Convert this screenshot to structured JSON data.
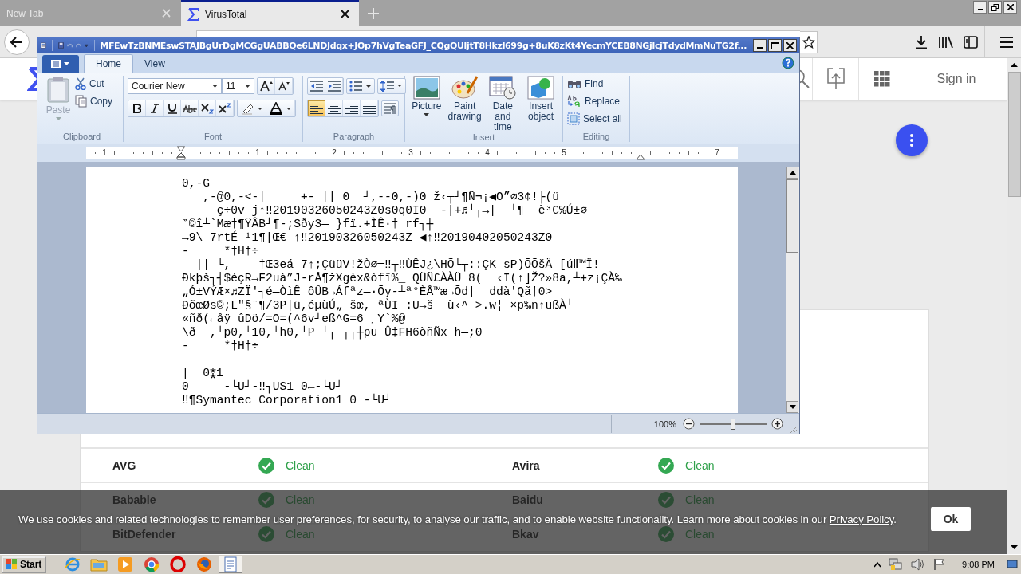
{
  "browser": {
    "tabs": [
      {
        "label": "New Tab",
        "selected": false,
        "icon": false
      },
      {
        "label": "VirusTotal",
        "selected": true,
        "icon": true
      }
    ]
  },
  "site_header": {
    "sign_in": "Sign in"
  },
  "results": {
    "rows": [
      {
        "engine_1": "AVG",
        "result_1": "Clean",
        "engine_2": "Avira",
        "result_2": "Clean"
      },
      {
        "engine_1": "Babable",
        "result_1": "Clean",
        "engine_2": "Baidu",
        "result_2": "Clean"
      },
      {
        "engine_1": "BitDefender",
        "result_1": "Clean",
        "engine_2": "Bkav",
        "result_2": "Clean"
      }
    ]
  },
  "cookie_banner": {
    "text": "We use cookies and related technologies to remember user preferences, for security, to analyse our traffic, and to enable website functionality. Learn more about cookies in our ",
    "link": "Privacy Policy",
    "after": ".",
    "button": "Ok"
  },
  "wordpad": {
    "title": "MFEwTzBNMEswSTAJBgUrDgMCGgUABBQe6LNDJdqx+JOp7hVgTeaGFJ_CQgQUljtT8Hkzl699g+8uK8zKt4YecmYCEB8NGjlcjTdydMmNuTG2f...",
    "tabs": [
      {
        "label": "Home",
        "selected": true
      },
      {
        "label": "View",
        "selected": false
      }
    ],
    "clipboard": {
      "label": "Clipboard",
      "paste": "Paste",
      "cut": "Cut",
      "copy": "Copy"
    },
    "font": {
      "label": "Font",
      "family": "Courier New",
      "size": "11"
    },
    "paragraph": {
      "label": "Paragraph",
      "alignments": [
        {
          "kind": "left",
          "selected": true
        },
        {
          "kind": "center",
          "selected": false
        },
        {
          "kind": "right",
          "selected": false
        },
        {
          "kind": "justify",
          "selected": false
        }
      ]
    },
    "insert": {
      "label": "Insert",
      "items": [
        {
          "kind": "picture",
          "label": "Picture",
          "dropdown": true
        },
        {
          "kind": "paint",
          "label": "Paint drawing",
          "dropdown": false
        },
        {
          "kind": "datetime",
          "label": "Date and time",
          "dropdown": false
        },
        {
          "kind": "object",
          "label": "Insert object",
          "dropdown": false
        }
      ]
    },
    "editing": {
      "label": "Editing",
      "find": "Find",
      "replace": "Replace",
      "select_all": "Select all"
    },
    "ruler": [
      "1",
      "1",
      "2",
      "3",
      "4",
      "5",
      "7"
    ],
    "document": "0,-G\n   ,-@0,-<-|     +- || 0  ┘,--0,-)0 ž‹┬┘¶Ñ¬¡◀Õ”⌀3¢!├(ü\n     ç÷0v j↑‼20190326050243Z0s0q0I0  -|+♬└┐→|  ┘¶  è³C%Ú±⌀\n‶©î┴`Mæ†¶ŸÂB┘¶-;Sðy3—¯}fï.+ÌÊ·† rf┐┼\n→9\\ 7rtÉ ¹1¶|Œ€ ↑‼20190326050243Z ◀↑‼20190402050243Z0\n-     *†H†÷\n  || └,    †Œ3eá 7↑;ÇüüV!žÒ⌀═‼┬‼ÙÊJ¿\\HÕ└┬::ÇK sP)ÕÕšÄ [úⅡ™Ï!\nÐkþš┐┤$éçR→F2uà”J-rÅ¶žXgèx&òfî%_ QÜÑ£ÀÀÜ 8(  ‹I(↑]Ž?»8a,┴+z¡ÇÀ‰\n„Ó±VÝÆ×♬ZÏ'┐é—ÒìÊ ôÛB→Áfªz—·Õy-┴ª°ÈÅ™æ→Õd|  ddà'Qã†0>\nÐõœØs©;L\"§¨¶/3P|ü,éµùÚ„ šœ, ªÙI :U→š  ù‹^ >.w¦ ×p‰n↑ußÀ┘\n«ñð(←åÿ ûDö/=Õ=(^6v┘eß^G=6 ¸Y`%@\n\\ð  ,┘p0,┘10,┘h0,└P └┐ ┐┐┼pu Û‡FH6òñÑx h—;0\n-     *†H†÷\n\n|  0⁑1\n0     -└U┘-‼┐US1 0←-└U┘\n‼¶Symantec Corporation1 0 -└U┘",
    "zoom": {
      "value": "100%",
      "level": 0.5
    }
  },
  "taskbar": {
    "start": "Start",
    "clock": "9:08 PM",
    "apps": [
      {
        "kind": "ie",
        "selected": false
      },
      {
        "kind": "folder",
        "selected": false
      },
      {
        "kind": "media",
        "selected": false
      },
      {
        "kind": "chrome",
        "selected": false
      },
      {
        "kind": "opera",
        "selected": false
      },
      {
        "kind": "firefox",
        "selected": false
      },
      {
        "kind": "wordpad",
        "selected": true
      }
    ]
  }
}
